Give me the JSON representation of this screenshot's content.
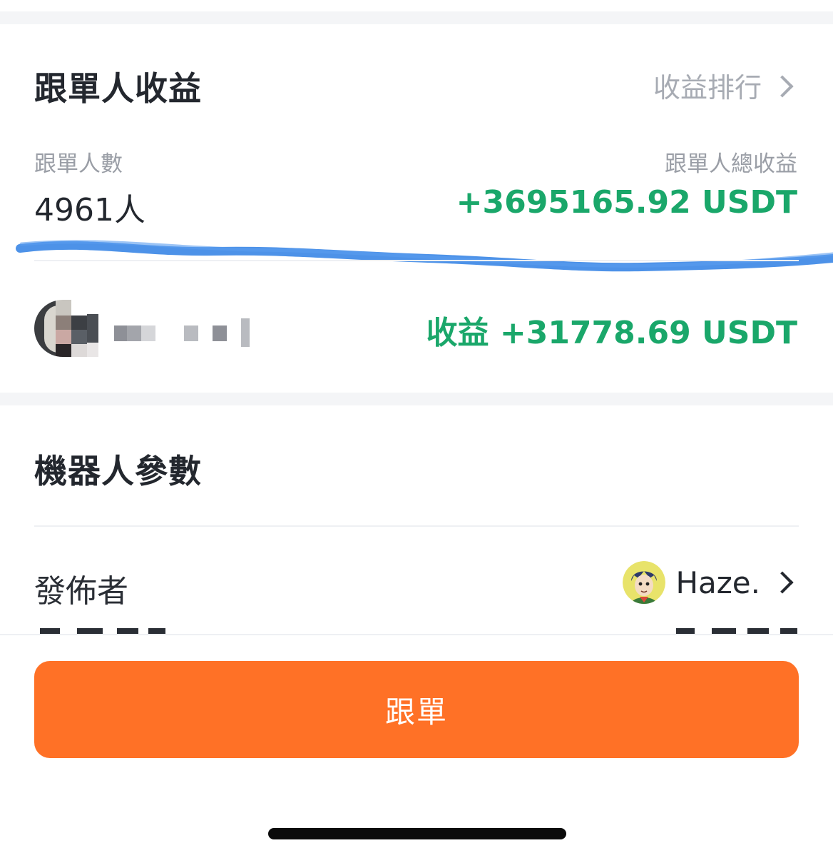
{
  "follower_section": {
    "title": "跟單人收益",
    "rank_link": "收益排行",
    "count_label": "跟單人數",
    "count_value": "4961人",
    "total_label": "跟單人總收益",
    "total_value": "+3695165.92 USDT",
    "top_follower": {
      "profit": "收益 +31778.69 USDT"
    }
  },
  "robot_section": {
    "title": "機器人參數",
    "publisher_label": "發佈者",
    "publisher_name": "Haze."
  },
  "action": {
    "follow_label": "跟單"
  },
  "colors": {
    "accent_orange": "#ff7126",
    "profit_green": "#1aa76a",
    "scribble_blue": "#3a86e6"
  }
}
